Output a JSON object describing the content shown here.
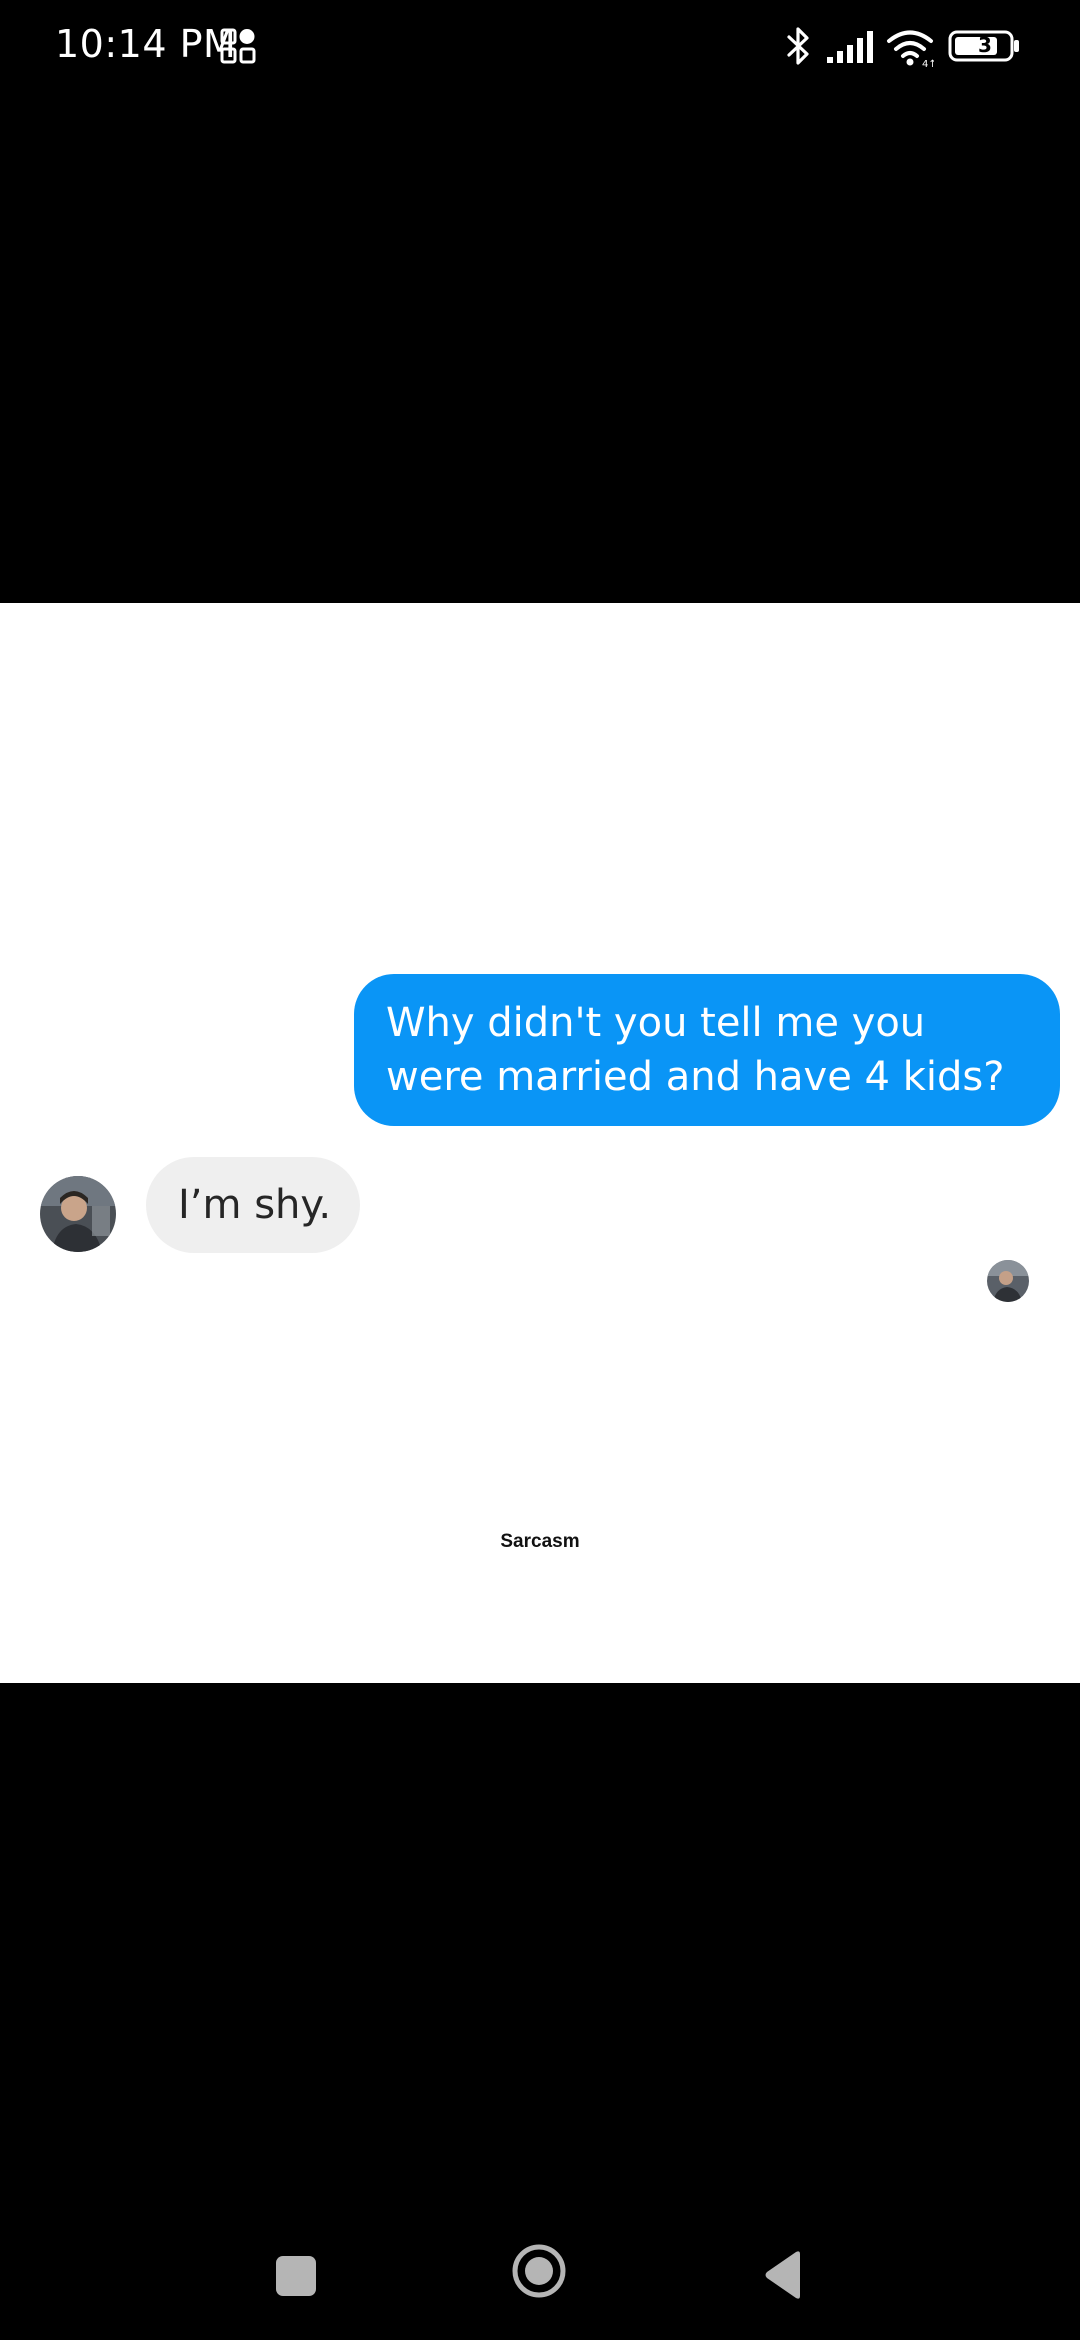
{
  "status_bar": {
    "time": "10:14 PM",
    "battery_level": "3",
    "icons": [
      "app-grid-icon",
      "bluetooth-icon",
      "signal-icon",
      "wifi-icon",
      "battery-icon"
    ]
  },
  "content": {
    "sent_message": "Why didn't you tell me you were married and have 4 kids?",
    "received_message": "I’m shy.",
    "caption": "Sarcasm",
    "colors": {
      "sent_bubble": "#0a95f6",
      "received_bubble": "#efefef",
      "image_background": "#ffffff"
    }
  },
  "nav_bar": {
    "buttons": [
      "recent-apps-button",
      "home-button",
      "back-button"
    ]
  }
}
